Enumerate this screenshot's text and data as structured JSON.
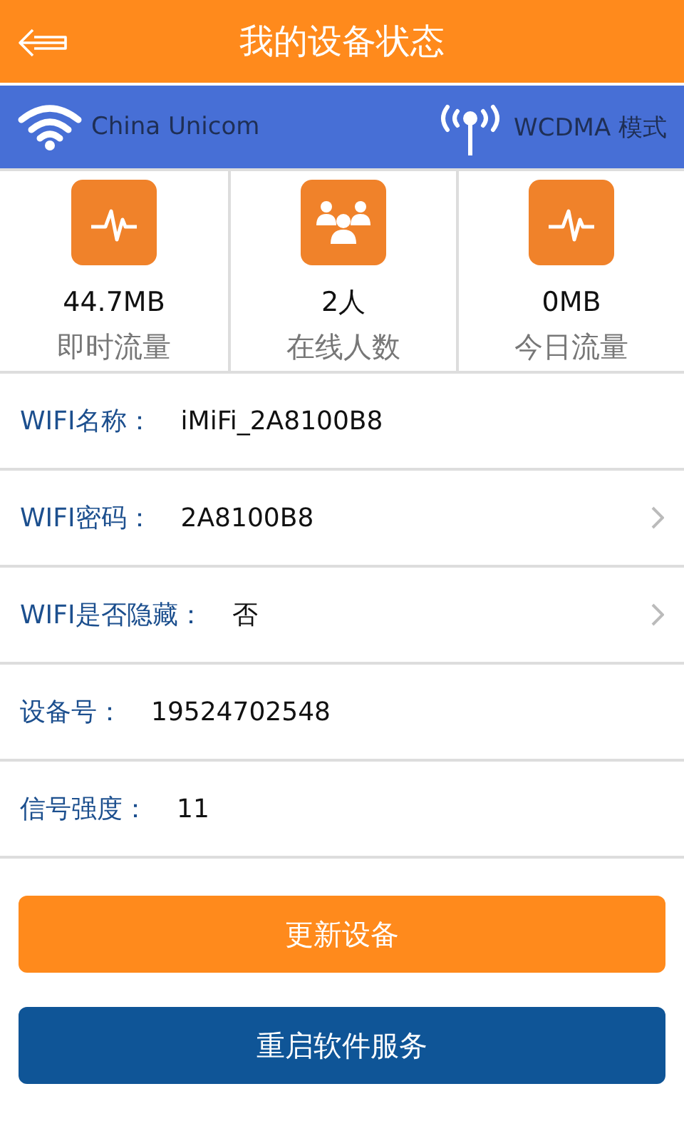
{
  "header": {
    "title": "我的设备状态"
  },
  "network_bar": {
    "carrier": "China Unicom",
    "mode": "WCDMA 模式"
  },
  "stats": [
    {
      "kind": "pulse",
      "value": "44.7MB",
      "label": "即时流量"
    },
    {
      "kind": "people",
      "value": "2人",
      "label": "在线人数"
    },
    {
      "kind": "pulse",
      "value": "0MB",
      "label": "今日流量"
    }
  ],
  "rows": [
    {
      "label": "WIFI名称：",
      "value": "iMiFi_2A8100B8",
      "navigable": false
    },
    {
      "label": "WIFI密码：",
      "value": "2A8100B8",
      "navigable": true
    },
    {
      "label": "WIFI是否隐藏：",
      "value": "否",
      "navigable": true
    },
    {
      "label": "设备号：",
      "value": "19524702548",
      "navigable": false
    },
    {
      "label": "信号强度：",
      "value": "11",
      "navigable": false
    }
  ],
  "buttons": [
    {
      "label": "更新设备",
      "kind": "primary"
    },
    {
      "label": "重启软件服务",
      "kind": "secondary"
    }
  ]
}
